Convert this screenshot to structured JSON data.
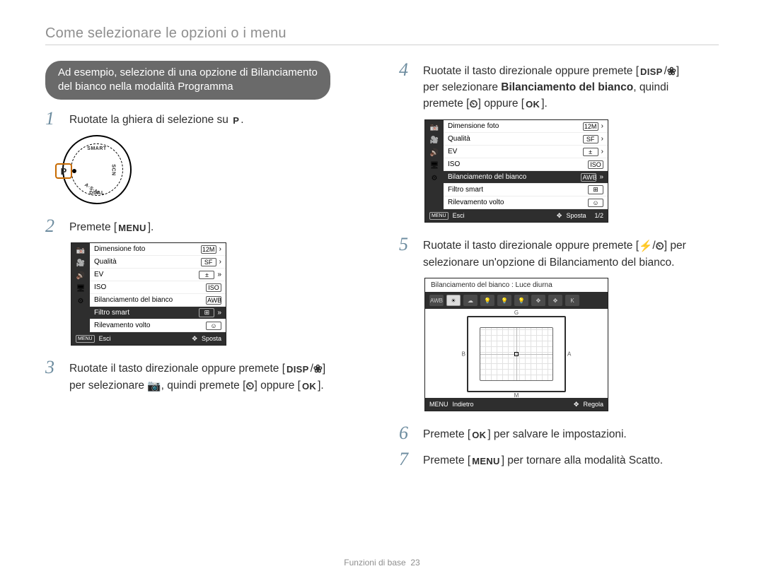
{
  "header": {
    "title": "Come selezionare le opzioni o i menu"
  },
  "example_box": {
    "line1": "Ad esempio, selezione di una opzione di Bilanciamento",
    "line2": "del bianco nella modalità Programma"
  },
  "steps": {
    "s1": {
      "num": "1",
      "text_a": "Ruotate la ghiera di selezione su ",
      "icon": "P",
      "text_b": "."
    },
    "s2": {
      "num": "2",
      "text_a": "Premete [",
      "icon": "MENU",
      "text_b": "]."
    },
    "s3": {
      "num": "3",
      "line1_a": "Ruotate il tasto direzionale oppure premete [",
      "line1_disp": "DISP",
      "line1_mid": "/",
      "line1_macro": "❀",
      "line1_b": "]",
      "line2_a": "per selezionare ",
      "line2_cam": "📷",
      "line2_b": ", quindi premete [",
      "line2_timer": "⏲",
      "line2_c": "] oppure [",
      "line2_ok": "OK",
      "line2_d": "]."
    },
    "s4": {
      "num": "4",
      "line1_a": "Ruotate il tasto direzionale oppure premete [",
      "line1_disp": "DISP",
      "line1_mid": "/",
      "line1_macro": "❀",
      "line1_b": "]",
      "line2_a": "per selezionare ",
      "line2_bold": "Bilanciamento del bianco",
      "line2_b": ", quindi",
      "line3_a": "premete [",
      "line3_timer": "⏲",
      "line3_b": "] oppure [",
      "line3_ok": "OK",
      "line3_c": "]."
    },
    "s5": {
      "num": "5",
      "line1_a": "Ruotate il tasto direzionale oppure premete [",
      "line1_flash": "⚡",
      "line1_mid": "/",
      "line1_timer": "⏲",
      "line1_b": "] per",
      "line2": "selezionare un'opzione di Bilanciamento del bianco."
    },
    "s6": {
      "num": "6",
      "text_a": "Premete [",
      "icon": "OK",
      "text_b": "] per salvare le impostazioni."
    },
    "s7": {
      "num": "7",
      "text_a": "Premete [",
      "icon": "MENU",
      "text_b": "] per tornare alla modalità Scatto."
    }
  },
  "dial": {
    "p": "P",
    "top": "SMART",
    "right": "SCN",
    "bottom_left": "A·S·M",
    "bottom_center": "DUAL"
  },
  "menu_items": [
    {
      "label": "Dimensione foto",
      "value": "12M"
    },
    {
      "label": "Qualità",
      "value": "SF"
    },
    {
      "label": "EV",
      "value": "±"
    },
    {
      "label": "ISO",
      "value": "ISO"
    },
    {
      "label": "Bilanciamento del bianco",
      "value": "AWB"
    },
    {
      "label": "Filtro smart",
      "value": "⊞"
    },
    {
      "label": "Rilevamento volto",
      "value": "☺"
    }
  ],
  "menu_foot": {
    "menu_btn": "MENU",
    "back": "Esci",
    "nav_icon": "✥",
    "move": "Sposta",
    "page": "1/2"
  },
  "wb_preview": {
    "title": "Bilanciamento del bianco : Luce diurna",
    "chips": [
      "AWB",
      "☀",
      "☁",
      "💡",
      "💡",
      "💡",
      "✥",
      "✥",
      "K"
    ],
    "axes": {
      "n": "G",
      "s": "M",
      "w": "B",
      "e": "A"
    },
    "foot": {
      "menu_btn": "MENU",
      "back": "Indietro",
      "nav_icon": "✥",
      "adjust": "Regola"
    }
  },
  "side_icons": [
    "📷",
    "🎥",
    "🔊",
    "🖥",
    "⚙"
  ],
  "footer": {
    "section": "Funzioni di base",
    "page": "23"
  }
}
